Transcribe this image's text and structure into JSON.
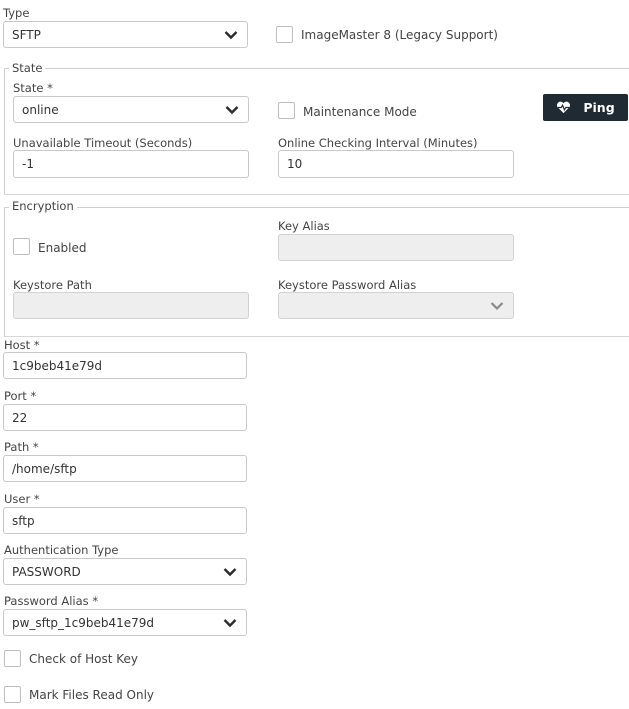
{
  "type": {
    "label": "Type",
    "value": "SFTP",
    "legacy_label": "ImageMaster 8 (Legacy Support)"
  },
  "state_section": {
    "legend": "State",
    "state_label": "State",
    "state_value": "online",
    "maintenance_label": "Maintenance Mode",
    "ping_label": "Ping",
    "unavailable_timeout_label": "Unavailable Timeout (Seconds)",
    "unavailable_timeout_value": "-1",
    "online_interval_label": "Online Checking Interval (Minutes)",
    "online_interval_value": "10"
  },
  "encryption": {
    "legend": "Encryption",
    "enabled_label": "Enabled",
    "key_alias_label": "Key Alias",
    "key_alias_value": "",
    "keystore_path_label": "Keystore Path",
    "keystore_path_value": "",
    "keystore_password_alias_label": "Keystore Password Alias",
    "keystore_password_alias_value": ""
  },
  "connection": {
    "host_label": "Host",
    "host_value": "1c9beb41e79d",
    "port_label": "Port",
    "port_value": "22",
    "path_label": "Path",
    "path_value": "/home/sftp",
    "user_label": "User",
    "user_value": "sftp",
    "auth_type_label": "Authentication Type",
    "auth_type_value": "PASSWORD",
    "password_alias_label": "Password Alias",
    "password_alias_value": "pw_sftp_1c9beb41e79d",
    "check_host_key_label": "Check of Host Key",
    "mark_read_only_label": "Mark Files Read Only"
  },
  "required_marker": "*",
  "colors": {
    "ping_bg": "#1f2a33",
    "border": "#c9c9c9",
    "disabled_bg": "#eeeeee"
  }
}
